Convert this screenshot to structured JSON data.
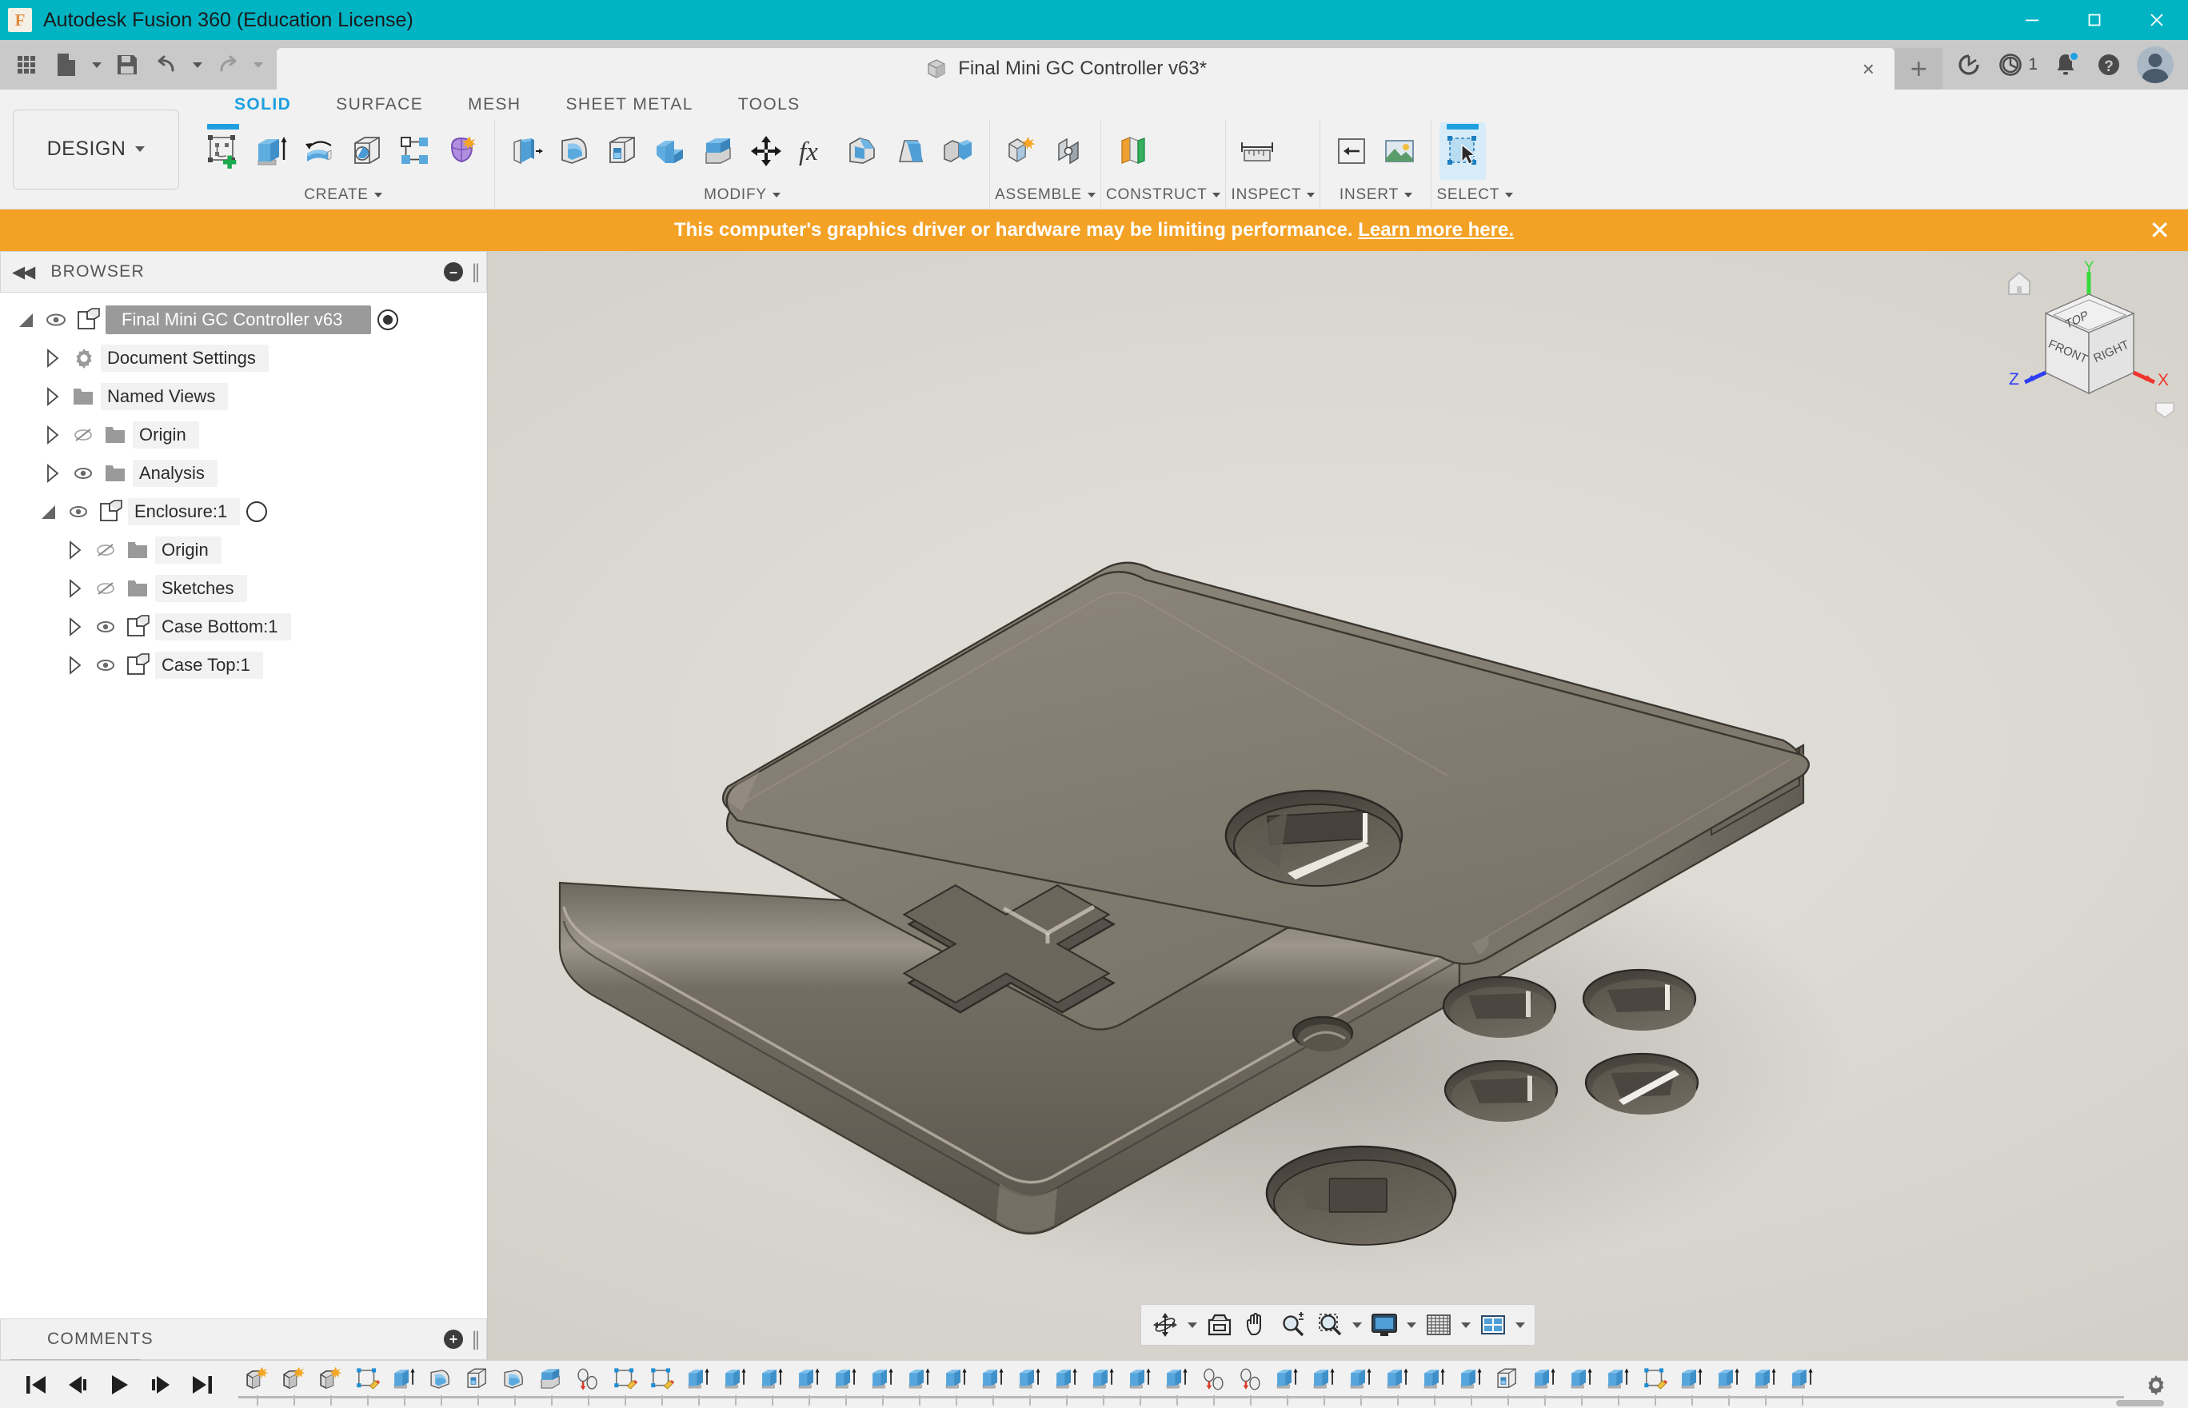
{
  "window": {
    "app_title": "Autodesk Fusion 360 (Education License)",
    "app_icon": "fusion-logo-icon",
    "titlebar_color": "#00b4c4",
    "minimize_label": "—",
    "maximize_label": "❐",
    "close_label": "✕"
  },
  "quick_access": {
    "items": [
      {
        "name": "show-data-panel",
        "icon": "grid-icon"
      },
      {
        "name": "file-menu",
        "icon": "file-icon",
        "has_caret": true
      },
      {
        "name": "save",
        "icon": "save-icon"
      },
      {
        "name": "undo",
        "icon": "undo-arrow-icon",
        "has_caret": true
      },
      {
        "name": "redo",
        "icon": "redo-arrow-icon",
        "has_caret": true
      }
    ]
  },
  "document_tab": {
    "label": "Final Mini GC Controller v63*",
    "icon": "cube-document-icon",
    "close_label": "×",
    "new_tab_label": "+"
  },
  "right_cluster": {
    "refresh_icon": "refresh-circle-icon",
    "job_status_icon": "clock-icon",
    "job_status_count": "1",
    "notifications_icon": "bell-icon",
    "help_icon": "question-mark-icon",
    "account_icon": "user-avatar"
  },
  "ribbon": {
    "workspace_label": "DESIGN",
    "tabs": [
      {
        "label": "SOLID",
        "active": true
      },
      {
        "label": "SURFACE",
        "active": false
      },
      {
        "label": "MESH",
        "active": false
      },
      {
        "label": "SHEET METAL",
        "active": false
      },
      {
        "label": "TOOLS",
        "active": false
      }
    ],
    "panels": [
      {
        "label": "CREATE",
        "has_caret": true,
        "tools": [
          {
            "name": "create-sketch-tool",
            "icon": "sketch-plus-icon",
            "active_underline": true
          },
          {
            "name": "extrude-tool",
            "icon": "extrude-icon"
          },
          {
            "name": "revolve-tool",
            "icon": "revolve-icon"
          },
          {
            "name": "hole-tool",
            "icon": "hole-icon"
          },
          {
            "name": "rectangular-pattern-tool",
            "icon": "pattern-icon"
          },
          {
            "name": "create-form-tool",
            "icon": "form-sculpt-icon"
          }
        ]
      },
      {
        "label": "MODIFY",
        "has_caret": true,
        "tools": [
          {
            "name": "press-pull-tool",
            "icon": "press-pull-icon"
          },
          {
            "name": "fillet-tool",
            "icon": "fillet-icon"
          },
          {
            "name": "shell-tool",
            "icon": "shell-icon"
          },
          {
            "name": "combine-tool",
            "icon": "combine-icon"
          },
          {
            "name": "split-face-tool",
            "icon": "split-face-icon"
          },
          {
            "name": "move-copy-tool",
            "icon": "move-arrows-icon"
          },
          {
            "name": "change-parameters-tool",
            "icon": "fx-icon"
          },
          {
            "name": "chamfer-tool",
            "icon": "chamfer-icon"
          },
          {
            "name": "draft-tool",
            "icon": "draft-icon"
          },
          {
            "name": "align-tool",
            "icon": "align-icon"
          }
        ]
      },
      {
        "label": "ASSEMBLE",
        "has_caret": true,
        "tools": [
          {
            "name": "new-component-tool",
            "icon": "new-component-icon"
          },
          {
            "name": "joint-tool",
            "icon": "joint-icon"
          }
        ]
      },
      {
        "label": "CONSTRUCT",
        "has_caret": true,
        "tools": [
          {
            "name": "offset-plane-tool",
            "icon": "offset-plane-icon"
          }
        ]
      },
      {
        "label": "INSPECT",
        "has_caret": true,
        "tools": [
          {
            "name": "measure-tool",
            "icon": "measure-ruler-icon"
          }
        ]
      },
      {
        "label": "INSERT",
        "has_caret": true,
        "tools": [
          {
            "name": "insert-derive-tool",
            "icon": "insert-derive-icon"
          },
          {
            "name": "insert-canvas-tool",
            "icon": "insert-image-icon"
          }
        ]
      },
      {
        "label": "SELECT",
        "has_caret": true,
        "tools": [
          {
            "name": "select-tool",
            "icon": "select-cursor-icon",
            "active_underline": true
          }
        ]
      }
    ]
  },
  "banner": {
    "message": "This computer's graphics driver or hardware may be limiting performance.",
    "link_text": "Learn more here.",
    "close_label": "✕",
    "background": "#f4a226"
  },
  "browser": {
    "header_title": "BROWSER",
    "collapse_icon": "double-chevron-left-icon",
    "minus_icon": "minus-circle-icon",
    "grip_icon": "resize-grip-icon",
    "tree": [
      {
        "label": "Final Mini GC Controller v63",
        "icon": "component-icon",
        "indent": 0,
        "expanded": true,
        "eye": "visible",
        "trail": "radio-filled",
        "selected": true
      },
      {
        "label": "Document Settings",
        "icon": "gear-icon",
        "indent": 1,
        "expanded": false,
        "eye": "none",
        "trail": "none",
        "selected": false
      },
      {
        "label": "Named Views",
        "icon": "folder-icon",
        "indent": 1,
        "expanded": false,
        "eye": "none",
        "trail": "none",
        "selected": false
      },
      {
        "label": "Origin",
        "icon": "folder-icon",
        "indent": 1,
        "expanded": false,
        "eye": "hidden",
        "trail": "none",
        "selected": false
      },
      {
        "label": "Analysis",
        "icon": "folder-icon",
        "indent": 1,
        "expanded": false,
        "eye": "visible",
        "trail": "none",
        "selected": false
      },
      {
        "label": "Enclosure:1",
        "icon": "component-icon",
        "indent": 1,
        "expanded": true,
        "eye": "visible",
        "trail": "radio-empty",
        "selected": false
      },
      {
        "label": "Origin",
        "icon": "folder-icon",
        "indent": 2,
        "expanded": false,
        "eye": "hidden",
        "trail": "none",
        "selected": false
      },
      {
        "label": "Sketches",
        "icon": "folder-icon",
        "indent": 2,
        "expanded": false,
        "eye": "hidden",
        "trail": "none",
        "selected": false
      },
      {
        "label": "Case Bottom:1",
        "icon": "component-icon",
        "indent": 2,
        "expanded": false,
        "eye": "visible",
        "trail": "none",
        "selected": false
      },
      {
        "label": "Case Top:1",
        "icon": "component-icon",
        "indent": 2,
        "expanded": false,
        "eye": "visible",
        "trail": "none",
        "selected": false
      }
    ]
  },
  "comments": {
    "header_title": "COMMENTS",
    "add_icon": "plus-circle-icon",
    "grip_icon": "resize-grip-icon"
  },
  "viewcube": {
    "top_face_label": "TOP",
    "front_face_label": "FRONT",
    "right_face_label": "RIGHT",
    "axis_x_label": "X",
    "axis_y_label": "Y",
    "axis_z_label": "Z",
    "axis_x_color": "#f0352e",
    "axis_y_color": "#34d93b",
    "axis_z_color": "#2f3ef5",
    "home_icon": "home-icon",
    "menu_icon": "chevron-down-shield-icon"
  },
  "navigation_bar": {
    "buttons": [
      {
        "name": "orbit-tool",
        "icon": "orbit-icon",
        "has_caret": true
      },
      {
        "name": "look-at-tool",
        "icon": "look-at-icon",
        "has_caret": false
      },
      {
        "name": "pan-tool",
        "icon": "hand-pan-icon",
        "has_caret": false
      },
      {
        "name": "zoom-tool",
        "icon": "zoom-plus-minus-icon",
        "has_caret": false
      },
      {
        "name": "zoom-window-tool",
        "icon": "zoom-window-icon",
        "has_caret": true
      },
      {
        "name": "display-settings",
        "icon": "monitor-icon",
        "has_caret": true
      },
      {
        "name": "grid-snap-settings",
        "icon": "grid-mesh-icon",
        "has_caret": true
      },
      {
        "name": "viewports-layout",
        "icon": "viewports-icon",
        "has_caret": true
      }
    ]
  },
  "model": {
    "body_color": "#807a70",
    "body_color_dark": "#4a463f",
    "body_color_light": "#928c81",
    "description": "Mini GameCube-style controller enclosure, isometric view"
  },
  "timeline": {
    "playback": [
      {
        "name": "go-to-beginning",
        "icon": "skip-start-icon"
      },
      {
        "name": "step-back",
        "icon": "step-back-icon"
      },
      {
        "name": "play",
        "icon": "play-icon"
      },
      {
        "name": "step-forward",
        "icon": "step-forward-icon"
      },
      {
        "name": "go-to-end",
        "icon": "skip-end-icon"
      }
    ],
    "features": [
      "new-component-icon",
      "new-component-icon",
      "new-component-icon",
      "sketch-icon",
      "extrude-icon",
      "fillet-icon",
      "shell-icon",
      "fillet-icon",
      "split-face-icon",
      "move-copy-icon",
      "sketch-icon",
      "sketch-icon",
      "extrude-icon",
      "extrude-icon",
      "extrude-icon",
      "extrude-icon",
      "extrude-icon",
      "extrude-icon",
      "extrude-icon",
      "extrude-icon",
      "extrude-icon",
      "extrude-icon",
      "extrude-icon",
      "extrude-icon",
      "extrude-icon",
      "extrude-icon",
      "joint-icon",
      "joint-icon",
      "extrude-icon",
      "extrude-icon",
      "extrude-icon",
      "extrude-icon",
      "extrude-icon",
      "extrude-icon",
      "shell-icon",
      "extrude-icon",
      "extrude-icon",
      "extrude-icon",
      "sketch-icon",
      "extrude-icon",
      "extrude-icon",
      "extrude-icon",
      "extrude-icon"
    ],
    "settings_icon": "gear-icon"
  }
}
